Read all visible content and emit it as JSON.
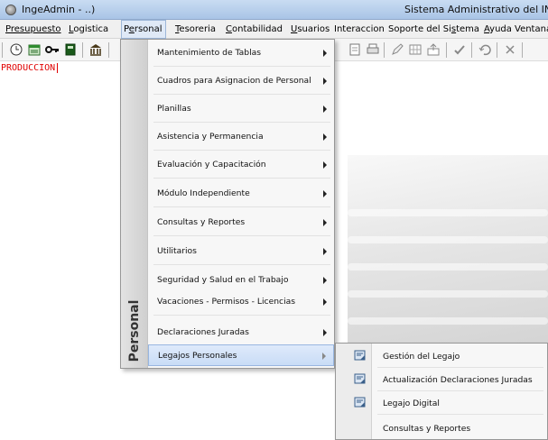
{
  "window": {
    "title": "IngeAdmin - ..)",
    "system_title": "Sistema Administrativo del INGEM"
  },
  "menubar": [
    {
      "label": "Presupuesto",
      "mnemonic_index": 0
    },
    {
      "label": "Logistica",
      "mnemonic_index": 0
    },
    {
      "label": "Personal",
      "mnemonic_index": 1
    },
    {
      "label": "Tesoreria",
      "mnemonic_index": 0
    },
    {
      "label": "Contabilidad",
      "mnemonic_index": 0
    },
    {
      "label": "Usuarios",
      "mnemonic_index": 0
    },
    {
      "label": "Interaccion",
      "mnemonic_index": -1
    },
    {
      "label": "Soporte del Sistema",
      "mnemonic_index": 14
    },
    {
      "label": "Ayuda",
      "mnemonic_index": 0
    },
    {
      "label": "Ventana",
      "mnemonic_index": -1
    }
  ],
  "status": {
    "environment_label": "PRODUCCION"
  },
  "personal_menu": {
    "side_label": "Personal",
    "items": [
      {
        "label": "Mantenimiento de Tablas",
        "submenu": true
      },
      {
        "label": "Cuadros para Asignacion de Personal",
        "submenu": true
      },
      {
        "label": "Planillas",
        "submenu": true
      },
      {
        "label": "Asistencia y Permanencia",
        "submenu": true
      },
      {
        "label": "Evaluación y Capacitación",
        "submenu": true
      },
      {
        "label": "Módulo Independiente",
        "submenu": true
      },
      {
        "label": "Consultas y Reportes",
        "submenu": true
      },
      {
        "label": "Utilitarios",
        "submenu": true
      },
      {
        "label": "Seguridad y Salud en el Trabajo",
        "submenu": true
      },
      {
        "label": "Vacaciones - Permisos - Licencias",
        "submenu": true
      },
      {
        "label": "Declaraciones Juradas",
        "submenu": true
      },
      {
        "label": "Legajos Personales",
        "submenu": true,
        "highlighted": true
      }
    ]
  },
  "legajos_submenu": {
    "items": [
      {
        "label": "Gestión del Legajo",
        "icon": "document-icon"
      },
      {
        "label": "Actualización Declaraciones Juradas",
        "icon": "document-icon"
      },
      {
        "label": "Legajo Digital",
        "icon": "document-icon"
      },
      {
        "label": "Consultas y Reportes",
        "icon": ""
      }
    ]
  },
  "colors": {
    "highlight": "#c9dcf6",
    "production_text": "#e00000",
    "titlebar": "#b8cfee"
  }
}
